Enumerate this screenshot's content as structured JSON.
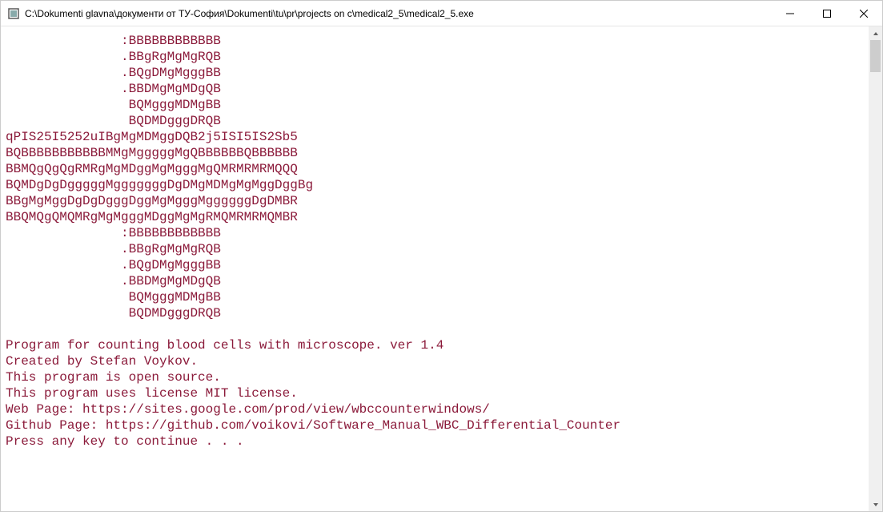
{
  "window": {
    "title": "C:\\Dokumenti glavna\\документи от ТУ-София\\Dokumenti\\tu\\pr\\projects on c\\medical2_5\\medical2_5.exe"
  },
  "console": {
    "color": "#8b1a3a",
    "lines": [
      "               :BBBBBBBBBBBB",
      "               .BBgRgMgMgRQB",
      "               .BQgDMgMgggBB",
      "               .BBDMgMgMDgQB",
      "                BQMgggMDMgBB",
      "                BQDMDgggDRQB",
      "qPIS25I5252uIBgMgMDMggDQB2j5ISI5IS2Sb5",
      "BQBBBBBBBBBBBMMgMgggggMgQBBBBBBQBBBBBB",
      "BBMQgQgQgRMRgMgMDggMgMgggMgQMRMRMRMQQQ",
      "BQMDgDgDgggggMgggggggDgDMgMDMgMgMggDggBg",
      "BBgMgMggDgDgDgggDggMgMgggMggggggDgDMBR",
      "BBQMQgQMQMRgMgMgggMDggMgMgRMQMRMRMQMBR",
      "               :BBBBBBBBBBBB",
      "               .BBgRgMgMgRQB",
      "               .BQgDMgMgggBB",
      "               .BBDMgMgMDgQB",
      "                BQMgggMDMgBB",
      "                BQDMDgggDRQB",
      "",
      "Program for counting blood cells with microscope. ver 1.4",
      "Created by Stefan Voykov.",
      "This program is open source.",
      "This program uses license MIT license.",
      "Web Page: https://sites.google.com/prod/view/wbccounterwindows/",
      "Github Page: https://github.com/voikovi/Software_Manual_WBC_Differential_Counter",
      "Press any key to continue . . ."
    ]
  }
}
